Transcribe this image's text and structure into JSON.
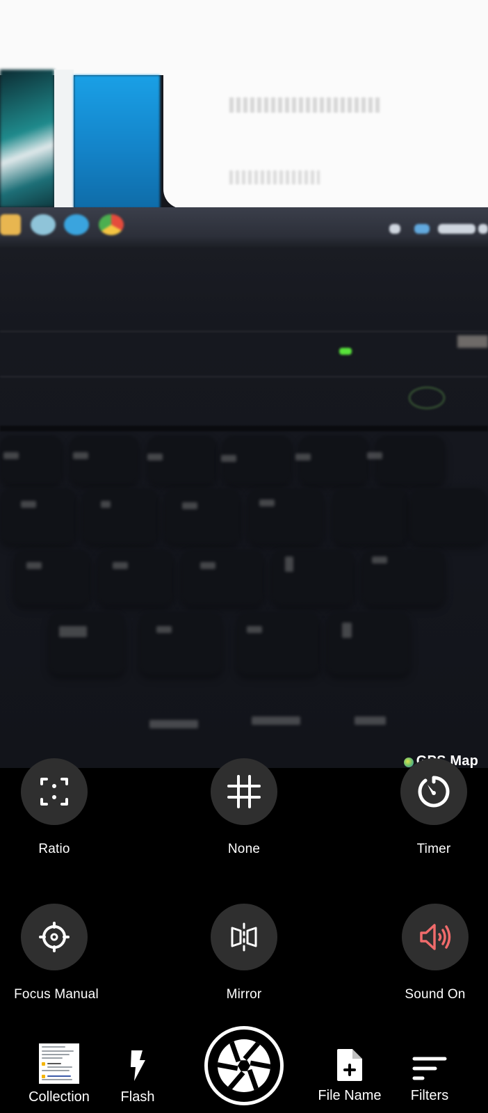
{
  "preview": {
    "overlay_label": "GPS Map",
    "overlay_icon": "gps-globe-icon"
  },
  "options": [
    {
      "id": "ratio",
      "label": "Ratio",
      "icon": "aspect-ratio-icon"
    },
    {
      "id": "grid",
      "label": "None",
      "icon": "grid-icon"
    },
    {
      "id": "timer",
      "label": "Timer",
      "icon": "timer-icon"
    },
    {
      "id": "focus",
      "label": "Focus Manual",
      "icon": "focus-target-icon"
    },
    {
      "id": "mirror",
      "label": "Mirror",
      "icon": "mirror-icon"
    },
    {
      "id": "sound",
      "label": "Sound On",
      "icon": "speaker-icon",
      "icon_color": "#f06b6b"
    }
  ],
  "bottom_bar": {
    "collection": {
      "label": "Collection",
      "icon": "gallery-thumbnail"
    },
    "flash": {
      "label": "Flash",
      "icon": "flash-icon"
    },
    "shutter": {
      "icon": "shutter-aperture-icon"
    },
    "file_name": {
      "label": "File Name",
      "icon": "file-add-icon"
    },
    "filters": {
      "label": "Filters",
      "icon": "filter-lines-icon"
    }
  },
  "colors": {
    "panel_bg": "#000000",
    "button_bg": "#2f2f2f",
    "icon": "#ffffff",
    "sound_accent": "#f06b6b"
  }
}
